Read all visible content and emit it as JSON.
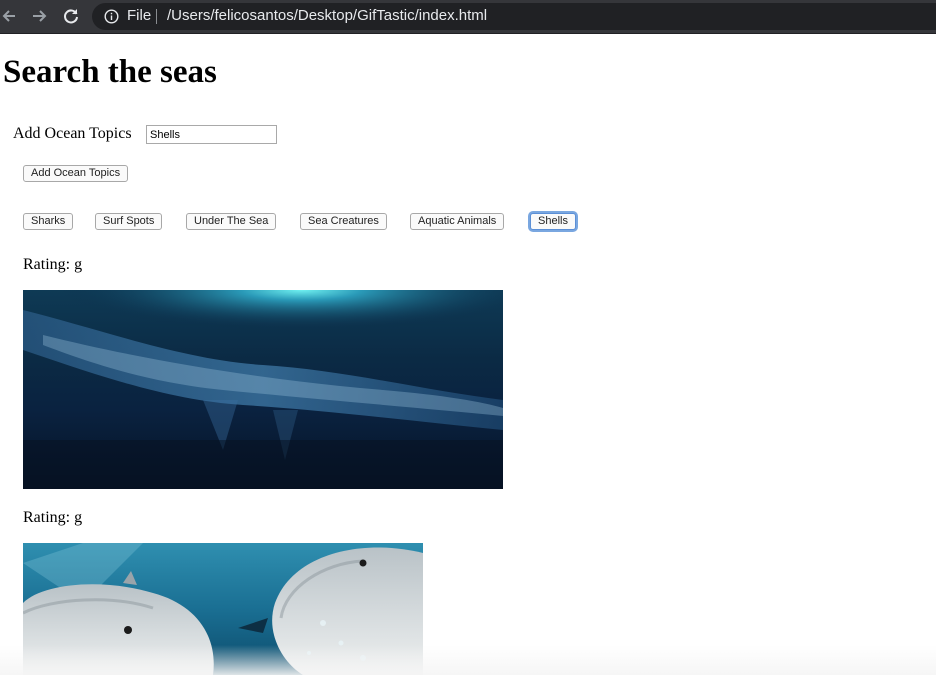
{
  "browser": {
    "file_label": "File",
    "url": "/Users/felicosantos/Desktop/GifTastic/index.html",
    "icons": [
      "back-arrow-icon",
      "forward-arrow-icon",
      "reload-icon",
      "info-icon"
    ]
  },
  "page": {
    "title": "Search the seas",
    "form": {
      "label": "Add Ocean Topics",
      "input_value": "Shells",
      "submit_label": "Add Ocean Topics"
    },
    "topics": [
      "Sharks",
      "Surf Spots",
      "Under The Sea",
      "Sea Creatures",
      "Aquatic Animals",
      "Shells"
    ],
    "active_topic": "Shells",
    "results": [
      {
        "rating": "Rating: g",
        "image": "underwater-wave-gif"
      },
      {
        "rating": "Rating: g",
        "image": "dolphins-gif"
      }
    ]
  },
  "colors": {
    "chrome_bg": "#35363a",
    "omnibox_bg": "#202124",
    "focus_ring": "#7aa7e0"
  }
}
